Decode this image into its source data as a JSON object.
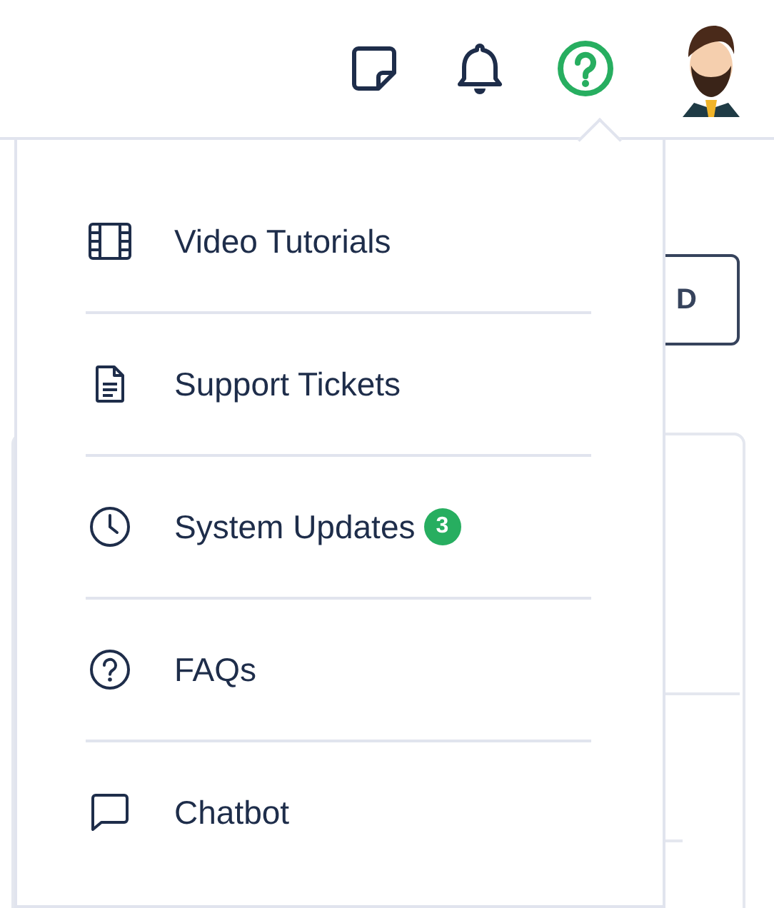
{
  "toolbar_buttons": [
    {
      "kind": "note",
      "selected": false
    },
    {
      "kind": "bell",
      "selected": false
    },
    {
      "kind": "help",
      "selected": true
    }
  ],
  "background": {
    "button_label": "D"
  },
  "help_menu": {
    "items": [
      {
        "kind": "video",
        "label": "Video Tutorials"
      },
      {
        "kind": "ticket",
        "label": "Support Tickets"
      },
      {
        "kind": "clock",
        "label": "System Updates",
        "badge": "3"
      },
      {
        "kind": "faq",
        "label": "FAQs"
      },
      {
        "kind": "chat",
        "label": "Chatbot"
      }
    ]
  }
}
